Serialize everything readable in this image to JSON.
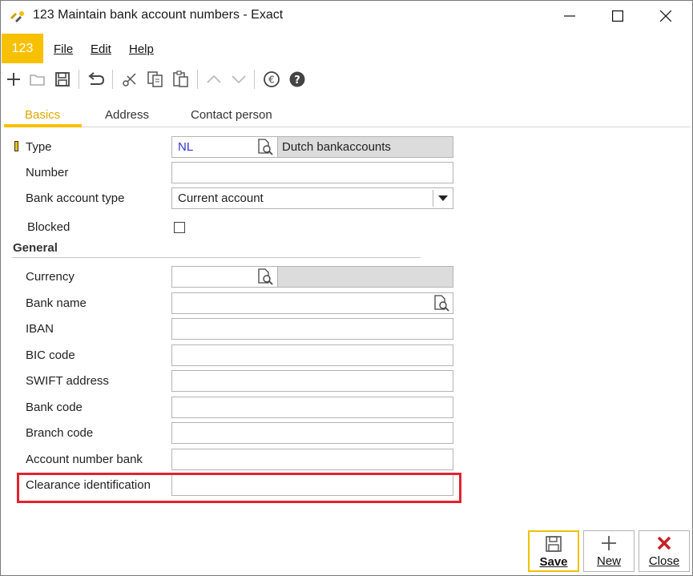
{
  "window": {
    "title": "123 Maintain bank account numbers - Exact"
  },
  "app_badge": "123",
  "menu": {
    "file": "File",
    "edit": "Edit",
    "help": "Help"
  },
  "toolbar": {
    "icons": [
      "add-icon",
      "open-folder-icon",
      "save-icon",
      "undo-icon",
      "cut-icon",
      "copy-icon",
      "paste-icon",
      "up-arrow-icon",
      "down-arrow-icon",
      "euro-icon",
      "help-icon"
    ]
  },
  "tabs": {
    "basics": "Basics",
    "address": "Address",
    "contact": "Contact person"
  },
  "form": {
    "type_label": "Type",
    "type_value": "NL",
    "type_description": "Dutch bankaccounts",
    "number_label": "Number",
    "number_value": "",
    "bank_account_type_label": "Bank account type",
    "bank_account_type_value": "Current account",
    "blocked_label": "Blocked",
    "blocked_checked": false,
    "general_section": "General",
    "currency_label": "Currency",
    "currency_value": "",
    "currency_description": "",
    "bank_name_label": "Bank name",
    "bank_name_value": "",
    "iban_label": "IBAN",
    "iban_value": "",
    "bic_label": "BIC code",
    "bic_value": "",
    "swift_label": "SWIFT address",
    "swift_value": "",
    "bank_code_label": "Bank code",
    "bank_code_value": "",
    "branch_code_label": "Branch code",
    "branch_code_value": "",
    "account_number_bank_label": "Account number bank",
    "account_number_bank_value": "",
    "clearance_label": "Clearance identification",
    "clearance_value": ""
  },
  "buttons": {
    "save": "Save",
    "new": "New",
    "close": "Close"
  },
  "colors": {
    "accent": "#f7c100",
    "type_value": "#3333cc",
    "highlight": "#e0232f",
    "close_icon": "#c8202a"
  }
}
